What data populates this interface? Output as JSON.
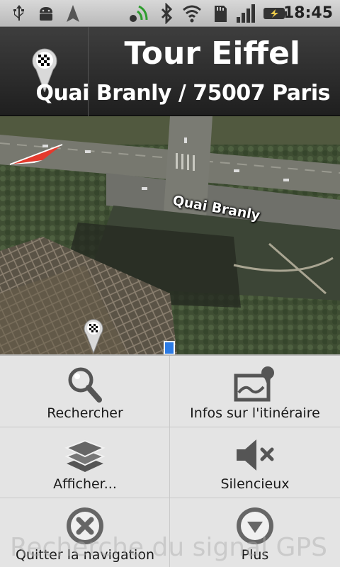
{
  "status_bar": {
    "time": "18:45",
    "icons": [
      "usb-icon",
      "android-debug-icon",
      "navigation-arrow-icon",
      "gps-signal-icon",
      "bluetooth-icon",
      "wifi-icon",
      "sd-card-icon",
      "cell-signal-icon",
      "battery-charging-icon"
    ]
  },
  "header": {
    "destination_icon": "checkered-flag-pin-icon",
    "title": "Tour Eiffel",
    "address": "Quai Branly / 75007 Paris"
  },
  "map": {
    "street_label": "Quai Branly",
    "markers": [
      "current-location-arrow-icon",
      "destination-pin-icon",
      "route-marker-icon"
    ]
  },
  "menu": {
    "ghost_text": "Recherche du signal GPS",
    "items": [
      {
        "label": "Rechercher",
        "icon": "search-icon"
      },
      {
        "label": "Infos sur l'itinéraire",
        "icon": "route-info-icon"
      },
      {
        "label": "Afficher...",
        "icon": "layers-icon"
      },
      {
        "label": "Silencieux",
        "icon": "mute-icon"
      },
      {
        "label": "Quitter la navigation",
        "icon": "close-circle-icon"
      },
      {
        "label": "Plus",
        "icon": "more-icon"
      }
    ]
  }
}
